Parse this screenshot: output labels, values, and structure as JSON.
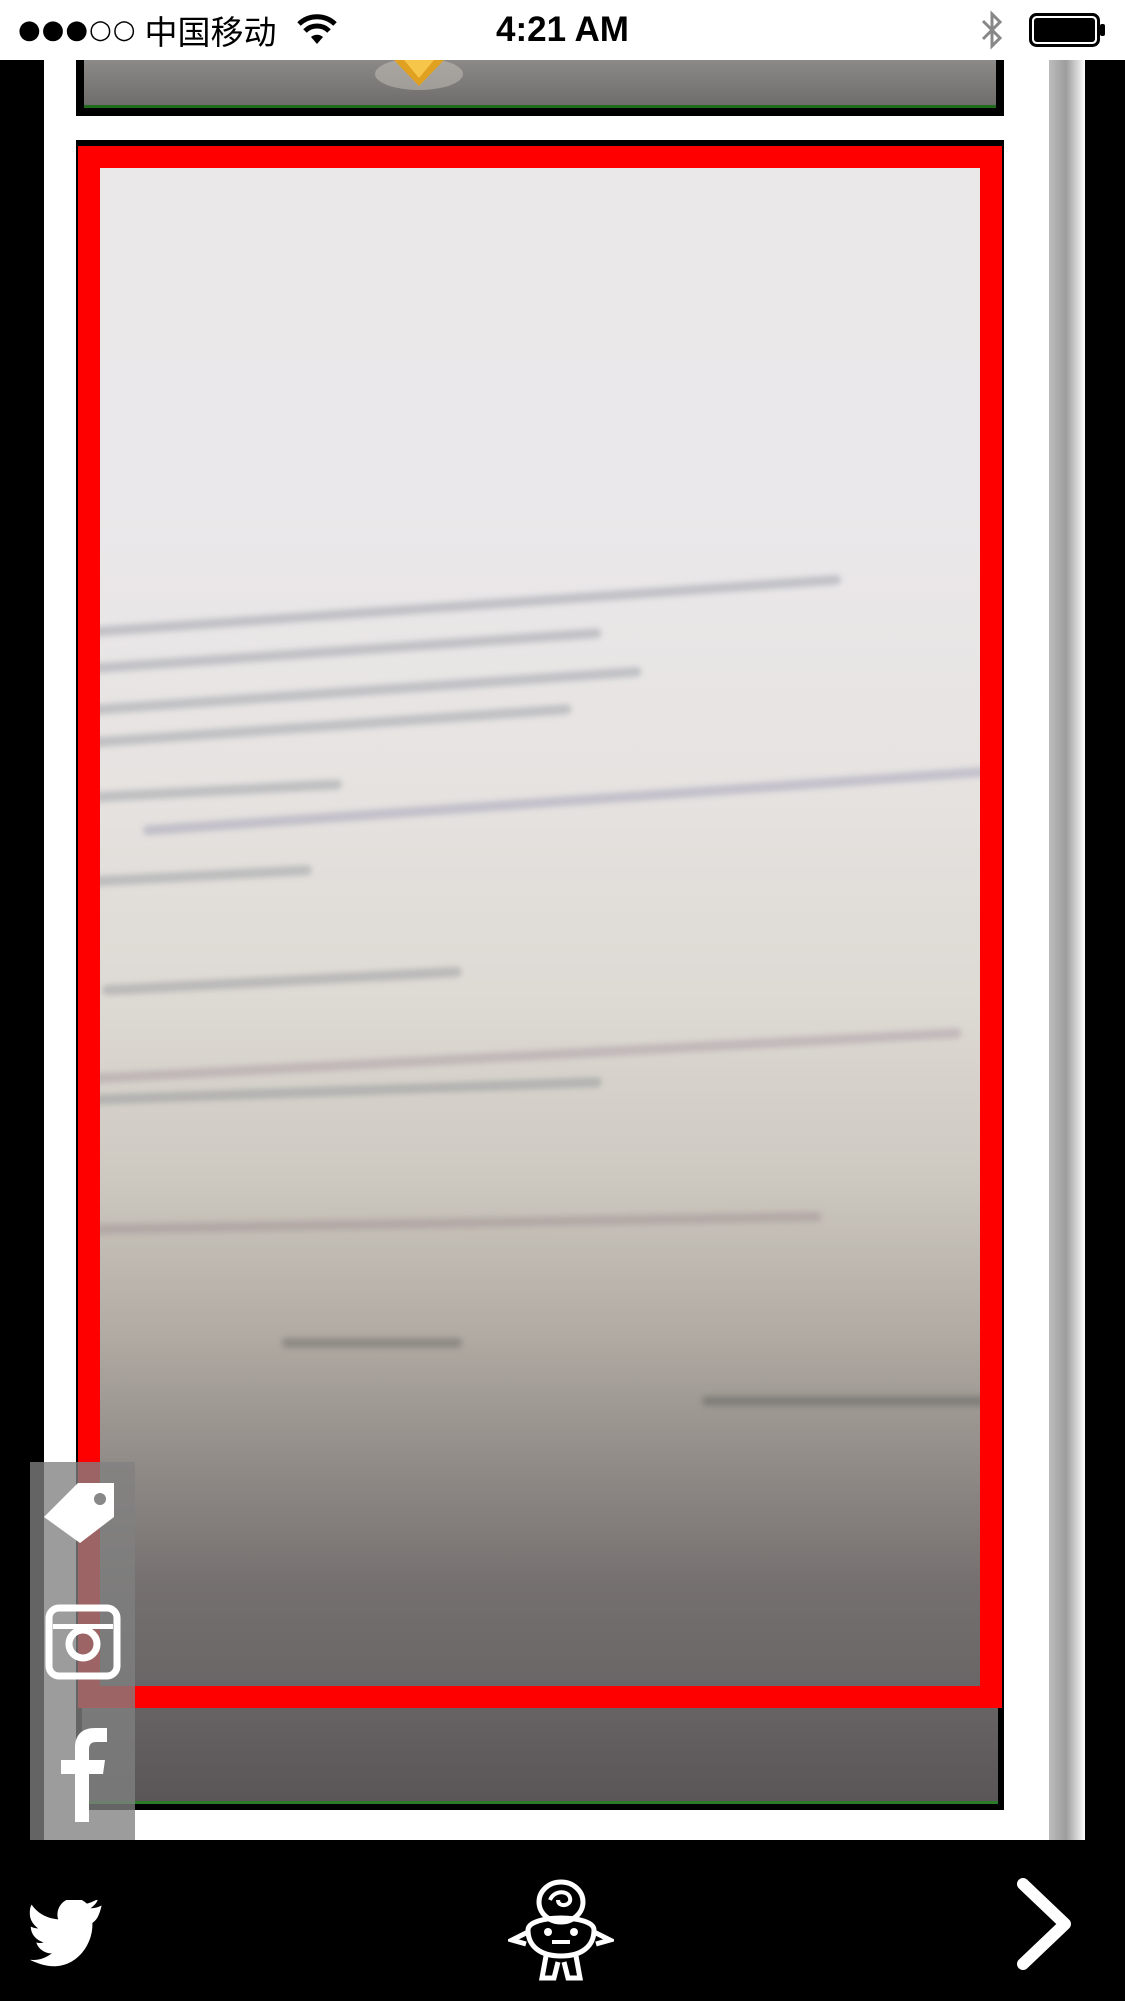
{
  "status_bar": {
    "signal": "●●●○○",
    "carrier": "中国移动",
    "time": "4:21 AM",
    "icons": [
      "wifi-icon",
      "bluetooth-icon",
      "battery-icon"
    ]
  },
  "viewer": {
    "previous_panel_icon": "gem-icon",
    "selection_color": "#ff0000"
  },
  "share_strip": {
    "items": [
      "tag-icon",
      "instagram-icon",
      "facebook-icon"
    ]
  },
  "bottom_bar": {
    "items": [
      "twitter-icon",
      "mascot-icon",
      "chevron-right-icon"
    ]
  }
}
